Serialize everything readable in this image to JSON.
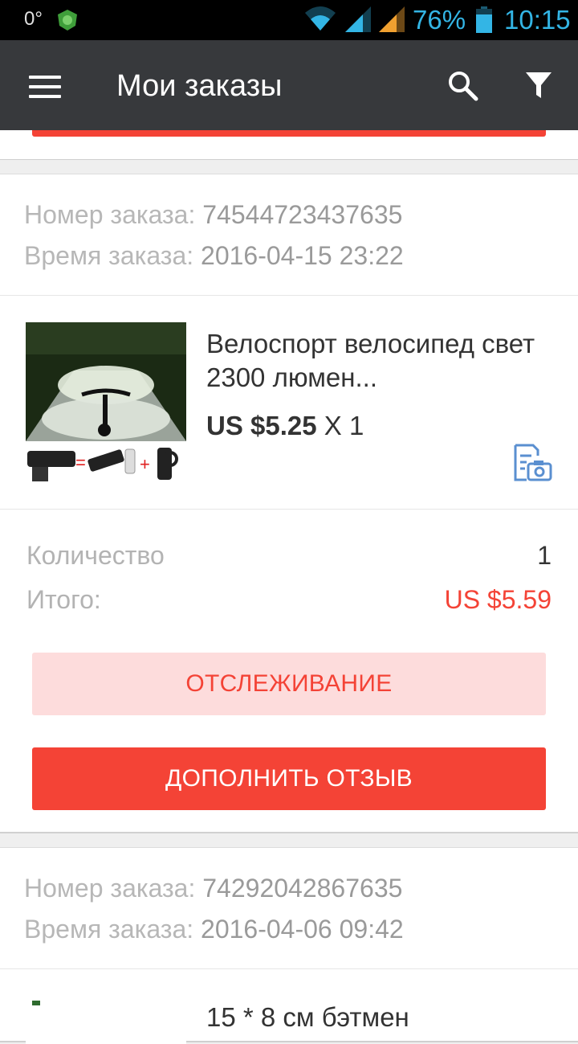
{
  "status_bar": {
    "temperature": "0°",
    "battery_percent": "76%",
    "time": "10:15",
    "accent_color": "#33b5e5"
  },
  "app_bar": {
    "title": "Мои заказы",
    "background": "#37393c"
  },
  "orders": [
    {
      "order_number_label": "Номер заказа:",
      "order_number": "74544723437635",
      "order_time_label": "Время заказа:",
      "order_time": "2016-04-15 23:22",
      "product": {
        "title": "Велоспорт велосипед свет 2300 люмен...",
        "price": "US $5.25",
        "quantity_text": " X 1"
      },
      "quantity_label": "Количество",
      "quantity_value": "1",
      "total_label": "Итого:",
      "total_value": "US $5.59",
      "track_button": "ОТСЛЕЖИВАНИЕ",
      "review_button": "ДОПОЛНИТЬ ОТЗЫВ"
    },
    {
      "order_number_label": "Номер заказа:",
      "order_number": "74292042867635",
      "order_time_label": "Время заказа:",
      "order_time": "2016-04-06 09:42",
      "product": {
        "title": "15 * 8 см бэтмен"
      }
    }
  ],
  "colors": {
    "accent_red": "#f44336",
    "light_red": "#fddcdc"
  }
}
